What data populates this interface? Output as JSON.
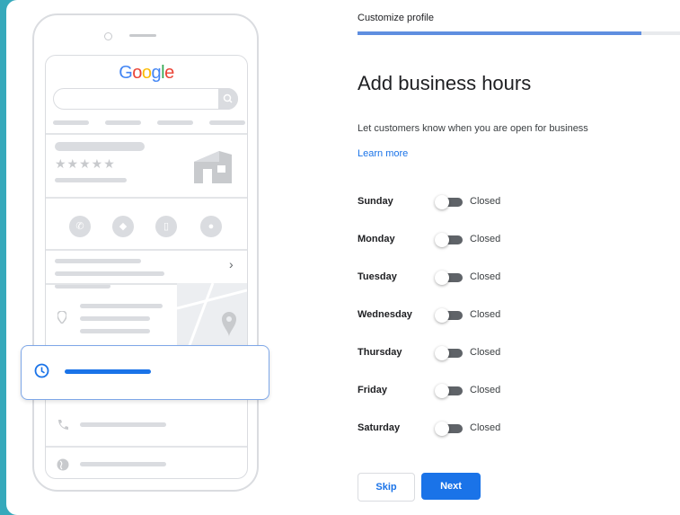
{
  "illustration": {
    "brand_letters": [
      "G",
      "o",
      "o",
      "g",
      "l",
      "e"
    ],
    "brand_colors": [
      "#4285f4",
      "#ea4335",
      "#fbbc05",
      "#4285f4",
      "#34a853",
      "#ea4335"
    ],
    "rating_stars": "★★★★★",
    "chevron": "›",
    "icons": [
      "phone-icon",
      "directions-icon",
      "bookmark-icon",
      "website-icon",
      "location-pin-icon",
      "clock-icon",
      "globe-icon"
    ]
  },
  "header": {
    "title": "Customize profile",
    "progress": 0.88
  },
  "main": {
    "title": "Add business hours",
    "description": "Let customers know when you are open for business",
    "learn_more": "Learn more",
    "days": [
      {
        "name": "Sunday",
        "status": "Closed"
      },
      {
        "name": "Monday",
        "status": "Closed"
      },
      {
        "name": "Tuesday",
        "status": "Closed"
      },
      {
        "name": "Wednesday",
        "status": "Closed"
      },
      {
        "name": "Thursday",
        "status": "Closed"
      },
      {
        "name": "Friday",
        "status": "Closed"
      },
      {
        "name": "Saturday",
        "status": "Closed"
      }
    ]
  },
  "buttons": {
    "skip": "Skip",
    "next": "Next"
  },
  "colors": {
    "accent": "#1a73e8",
    "background": "#36a9bb",
    "toggle_off": "#5f6368"
  }
}
